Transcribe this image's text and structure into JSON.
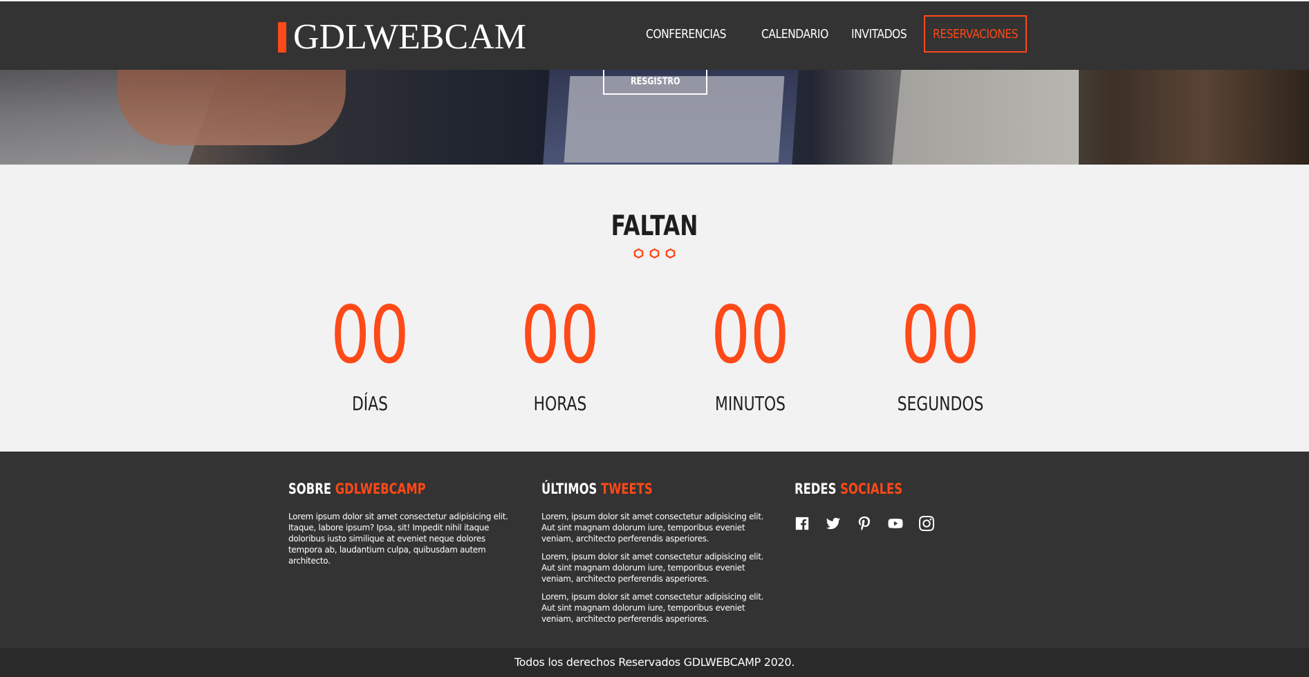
{
  "header": {
    "logo": "GDLWEBCAM",
    "nav": [
      {
        "label": "CONFERENCIAS"
      },
      {
        "label": "CALENDARIO"
      },
      {
        "label": "INVITADOS"
      },
      {
        "label": "RESERVACIONES"
      }
    ]
  },
  "hero": {
    "register_label": "RESGISTRO"
  },
  "countdown": {
    "title": "FALTAN",
    "items": [
      {
        "value": "00",
        "label": "DÍAS"
      },
      {
        "value": "00",
        "label": "HORAS"
      },
      {
        "value": "00",
        "label": "MINUTOS"
      },
      {
        "value": "00",
        "label": "SEGUNDOS"
      }
    ]
  },
  "footer": {
    "about": {
      "title_plain": "SOBRE",
      "title_accent": "GDLWEBCAMP",
      "text": "Lorem ipsum dolor sit amet consectetur adipisicing elit. Itaque, labore ipsum? Ipsa, sit! Impedit nihil itaque doloribus iusto similique at eveniet neque dolores tempora ab, laudantium culpa, quibusdam autem architecto."
    },
    "tweets": {
      "title_plain": "ÚLTIMOS",
      "title_accent": "TWEETS",
      "items": [
        "Lorem, ipsum dolor sit amet consectetur adipisicing elit. Aut sint magnam dolorum iure, temporibus eveniet veniam, architecto perferendis asperiores.",
        "Lorem, ipsum dolor sit amet consectetur adipisicing elit. Aut sint magnam dolorum iure, temporibus eveniet veniam, architecto perferendis asperiores.",
        "Lorem, ipsum dolor sit amet consectetur adipisicing elit. Aut sint magnam dolorum iure, temporibus eveniet veniam, architecto perferendis asperiores."
      ]
    },
    "social": {
      "title_plain": "REDES",
      "title_accent": "SOCIALES",
      "icons": [
        "facebook-icon",
        "twitter-icon",
        "pinterest-icon",
        "youtube-icon",
        "instagram-icon"
      ]
    },
    "copyright": "Todos los derechos Reservados GDLWEBCAMP 2020."
  },
  "colors": {
    "accent": "#fe4918",
    "dark": "#333333",
    "light_bg": "#f2f2f2"
  }
}
